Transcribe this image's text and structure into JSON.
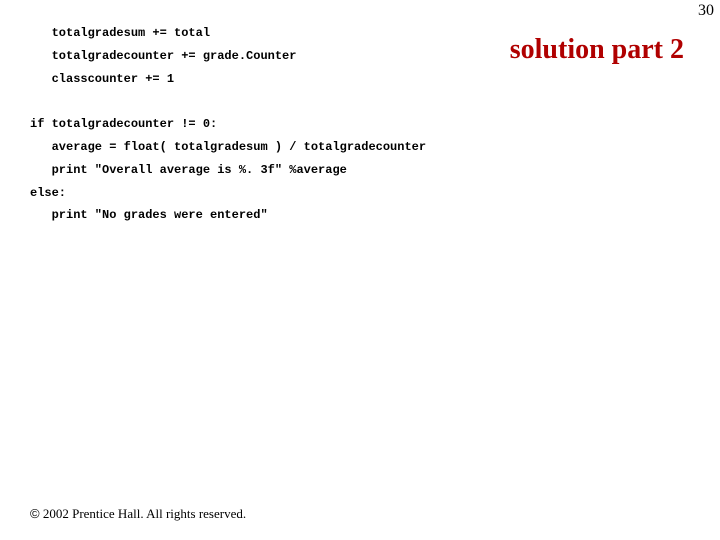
{
  "page_number": "30",
  "title": "solution part 2",
  "code": {
    "l1": "   totalgradesum += total",
    "l2": "   totalgradecounter += grade.Counter",
    "l3": "   classcounter += 1",
    "l4": "",
    "l5": "if totalgradecounter != 0:",
    "l6": "   average = float( totalgradesum ) / totalgradecounter",
    "l7": "   print \"Overall average is %. 3f\" %average",
    "l8": "else:",
    "l9": "   print \"No grades were entered\""
  },
  "footer": "2002 Prentice Hall. All rights reserved.",
  "copyright_symbol": "©"
}
